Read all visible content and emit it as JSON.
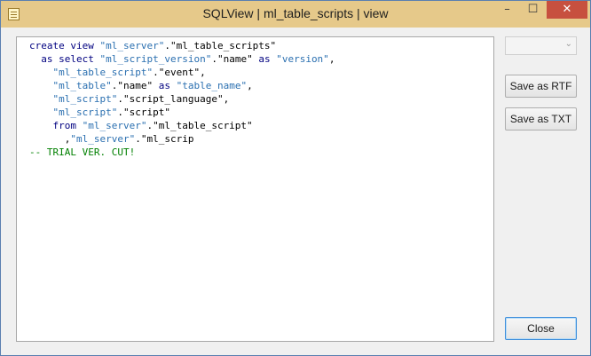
{
  "window": {
    "title": "SQLView | ml_table_scripts | view",
    "controls": {
      "minimize": "–",
      "maximize": "☐",
      "close": "✕"
    }
  },
  "editor": {
    "lines": [
      [
        [
          "kw",
          "create view "
        ],
        [
          "str",
          "\"ml_server\""
        ],
        [
          "txt",
          "."
        ],
        [
          "txt",
          "\"ml_table_scripts\""
        ]
      ],
      [
        [
          "kw",
          "  as select "
        ],
        [
          "str",
          "\"ml_script_version\""
        ],
        [
          "txt",
          "."
        ],
        [
          "txt",
          "\"name\""
        ],
        [
          "kw",
          " as "
        ],
        [
          "str",
          "\"version\""
        ],
        [
          "txt",
          ","
        ]
      ],
      [
        [
          "txt",
          "    "
        ],
        [
          "str",
          "\"ml_table_script\""
        ],
        [
          "txt",
          "."
        ],
        [
          "txt",
          "\"event\""
        ],
        [
          "txt",
          ","
        ]
      ],
      [
        [
          "txt",
          "    "
        ],
        [
          "str",
          "\"ml_table\""
        ],
        [
          "txt",
          "."
        ],
        [
          "txt",
          "\"name\""
        ],
        [
          "kw",
          " as "
        ],
        [
          "str",
          "\"table_name\""
        ],
        [
          "txt",
          ","
        ]
      ],
      [
        [
          "txt",
          "    "
        ],
        [
          "str",
          "\"ml_script\""
        ],
        [
          "txt",
          "."
        ],
        [
          "txt",
          "\"script_language\""
        ],
        [
          "txt",
          ","
        ]
      ],
      [
        [
          "txt",
          "    "
        ],
        [
          "str",
          "\"ml_script\""
        ],
        [
          "txt",
          "."
        ],
        [
          "txt",
          "\"script\""
        ]
      ],
      [
        [
          "kw",
          "    from "
        ],
        [
          "str",
          "\"ml_server\""
        ],
        [
          "txt",
          "."
        ],
        [
          "txt",
          "\"ml_table_script\""
        ]
      ],
      [
        [
          "txt",
          "      ,"
        ],
        [
          "str",
          "\"ml_server\""
        ],
        [
          "txt",
          "."
        ],
        [
          "txt",
          "\"ml_scrip"
        ]
      ],
      [
        [
          "cmt",
          "-- TRIAL VER. CUT!"
        ]
      ]
    ]
  },
  "sidebar": {
    "combo_value": "",
    "save_rtf_label": "Save as RTF",
    "save_txt_label": "Save as TXT",
    "close_label": "Close"
  },
  "colors": {
    "titlebar": "#e6c98a",
    "keyword": "#000080",
    "string": "#2a6fb0",
    "comment": "#008000",
    "close_hover": "#c7503f"
  }
}
